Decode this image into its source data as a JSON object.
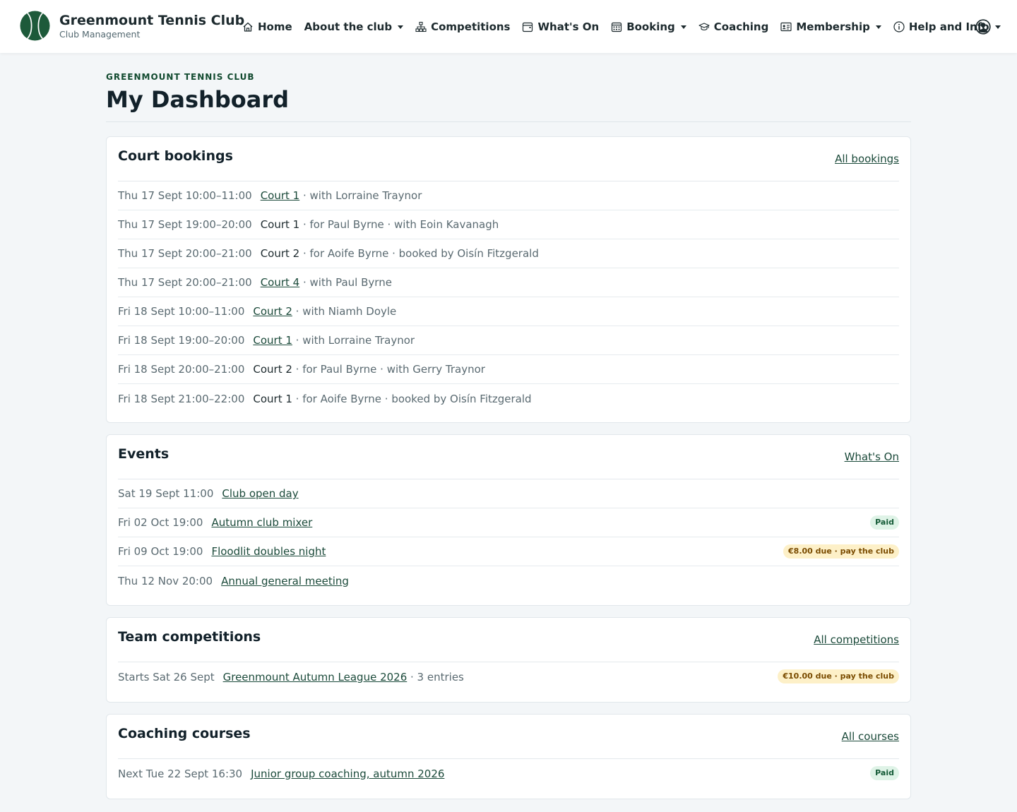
{
  "brand": {
    "name": "Greenmount Tennis Club",
    "subtitle": "Club Management"
  },
  "nav": [
    {
      "label": "Home",
      "icon": "home-icon"
    },
    {
      "label": "About the club",
      "icon": "",
      "dropdown": true
    },
    {
      "label": "Competitions",
      "icon": "sitemap-icon"
    },
    {
      "label": "What's On",
      "icon": "calendar-icon"
    },
    {
      "label": "Booking",
      "icon": "calendar-grid-icon",
      "dropdown": true
    },
    {
      "label": "Coaching",
      "icon": "graduation-cap-icon"
    },
    {
      "label": "Membership",
      "icon": "id-card-icon",
      "dropdown": true
    },
    {
      "label": "Help and Info",
      "icon": "info-icon",
      "dropdown": true
    }
  ],
  "page": {
    "kicker": "GREENMOUNT TENNIS CLUB",
    "title": "My Dashboard"
  },
  "bookings": {
    "title": "Court bookings",
    "link": "All bookings",
    "rows": [
      {
        "when": "Thu 17 Sept 10:00–11:00",
        "court": "Court 1",
        "linked": true,
        "rest": " · with Lorraine Traynor"
      },
      {
        "when": "Thu 17 Sept 19:00–20:00",
        "court": "Court 1",
        "linked": false,
        "rest": " · for Paul Byrne · with Eoin Kavanagh"
      },
      {
        "when": "Thu 17 Sept 20:00–21:00",
        "court": "Court 2",
        "linked": false,
        "rest": " · for Aoife Byrne · booked by Oisín Fitzgerald"
      },
      {
        "when": "Thu 17 Sept 20:00–21:00",
        "court": "Court 4",
        "linked": true,
        "rest": " · with Paul Byrne"
      },
      {
        "when": "Fri 18 Sept 10:00–11:00",
        "court": "Court 2",
        "linked": true,
        "rest": " · with Niamh Doyle"
      },
      {
        "when": "Fri 18 Sept 19:00–20:00",
        "court": "Court 1",
        "linked": true,
        "rest": " · with Lorraine Traynor"
      },
      {
        "when": "Fri 18 Sept 20:00–21:00",
        "court": "Court 2",
        "linked": false,
        "rest": " · for Paul Byrne · with Gerry Traynor"
      },
      {
        "when": "Fri 18 Sept 21:00–22:00",
        "court": "Court 1",
        "linked": false,
        "rest": " · for Aoife Byrne · booked by Oisín Fitzgerald"
      }
    ]
  },
  "events": {
    "title": "Events",
    "link": "What's On",
    "rows": [
      {
        "when": "Sat 19 Sept 11:00",
        "name": "Club open day",
        "badge": "",
        "badge_type": ""
      },
      {
        "when": "Fri 02 Oct 19:00",
        "name": "Autumn club mixer",
        "badge": "Paid",
        "badge_type": "paid"
      },
      {
        "when": "Fri 09 Oct 19:00",
        "name": "Floodlit doubles night",
        "badge": "€8.00 due · pay the club",
        "badge_type": "due"
      },
      {
        "when": "Thu 12 Nov 20:00",
        "name": "Annual general meeting",
        "badge": "",
        "badge_type": ""
      }
    ]
  },
  "competitions": {
    "title": "Team competitions",
    "link": "All competitions",
    "rows": [
      {
        "when": "Starts Sat 26 Sept",
        "name": "Greenmount Autumn League 2026",
        "rest": " · 3 entries",
        "badge": "€10.00 due · pay the club",
        "badge_type": "due"
      }
    ]
  },
  "coaching": {
    "title": "Coaching courses",
    "link": "All courses",
    "rows": [
      {
        "when": "Next Tue 22 Sept 16:30",
        "name": "Junior group coaching, autumn 2026",
        "badge": "Paid",
        "badge_type": "paid"
      }
    ]
  },
  "colors": {
    "brand_green": "#1d5a3a",
    "link": "#1b4a3a",
    "paid_bg": "#dff3e7",
    "due_bg": "#fdf0c8"
  }
}
